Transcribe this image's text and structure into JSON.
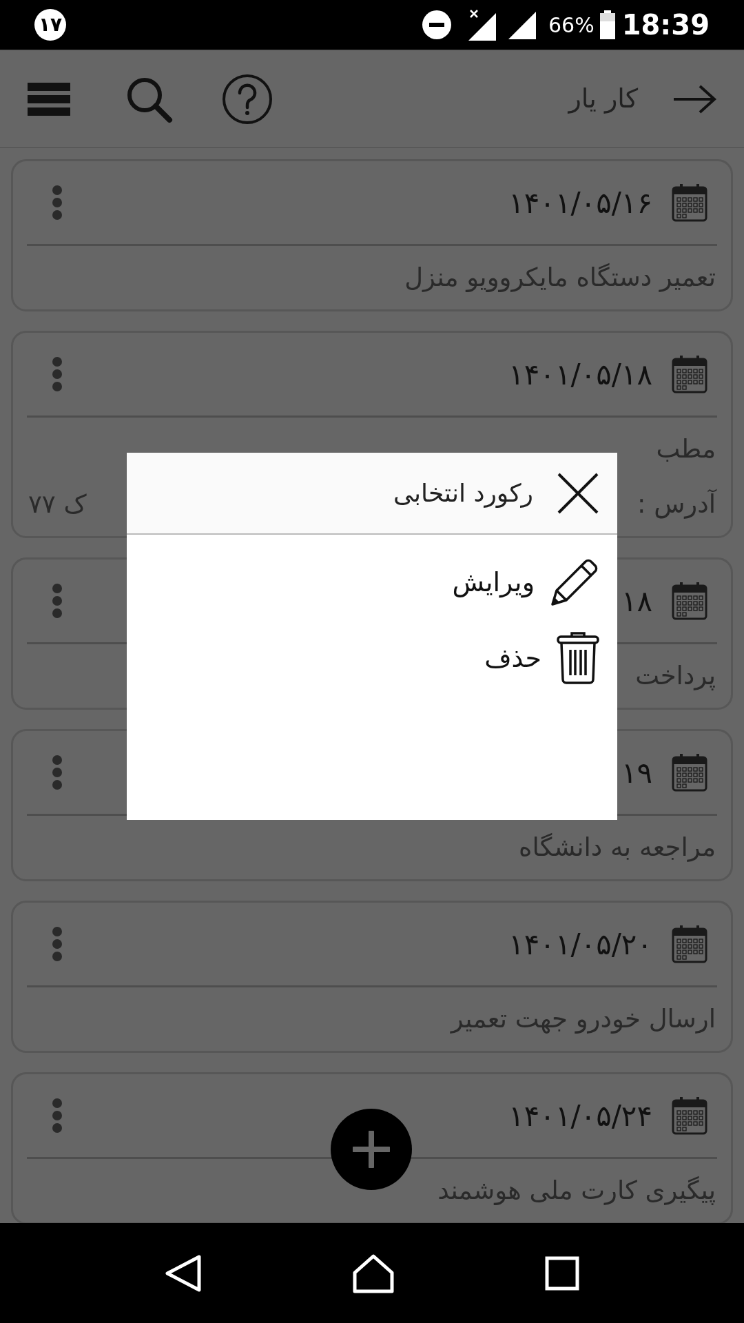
{
  "status_bar": {
    "notification_badge": "۱۷",
    "battery_percent": "66%",
    "time": "18:39"
  },
  "app_bar": {
    "title": "کار یار"
  },
  "cards": [
    {
      "date": "۱۴۰۱/۰۵/۱۶",
      "lines": [
        [
          "تعمیر دستگاه مایکروویو منزل"
        ]
      ]
    },
    {
      "date": "۱۴۰۱/۰۵/۱۸",
      "lines": [
        [
          "مطب"
        ],
        [
          "آدرس :",
          "ک ۷۷"
        ]
      ]
    },
    {
      "date": "۱۸",
      "lines": [
        [
          "پرداخت"
        ]
      ]
    },
    {
      "date": "۱۹",
      "lines": [
        [
          "مراجعه به دانشگاه"
        ]
      ]
    },
    {
      "date": "۱۴۰۱/۰۵/۲۰",
      "lines": [
        [
          "ارسال خودرو جهت تعمیر"
        ]
      ]
    },
    {
      "date": "۱۴۰۱/۰۵/۲۴",
      "lines": [
        [
          "پیگیری کارت ملی هوشمند"
        ]
      ]
    }
  ],
  "dialog": {
    "title": "رکورد انتخابی",
    "actions": [
      {
        "kind": "edit",
        "label": "ویرایش"
      },
      {
        "kind": "delete",
        "label": "حذف"
      }
    ]
  }
}
